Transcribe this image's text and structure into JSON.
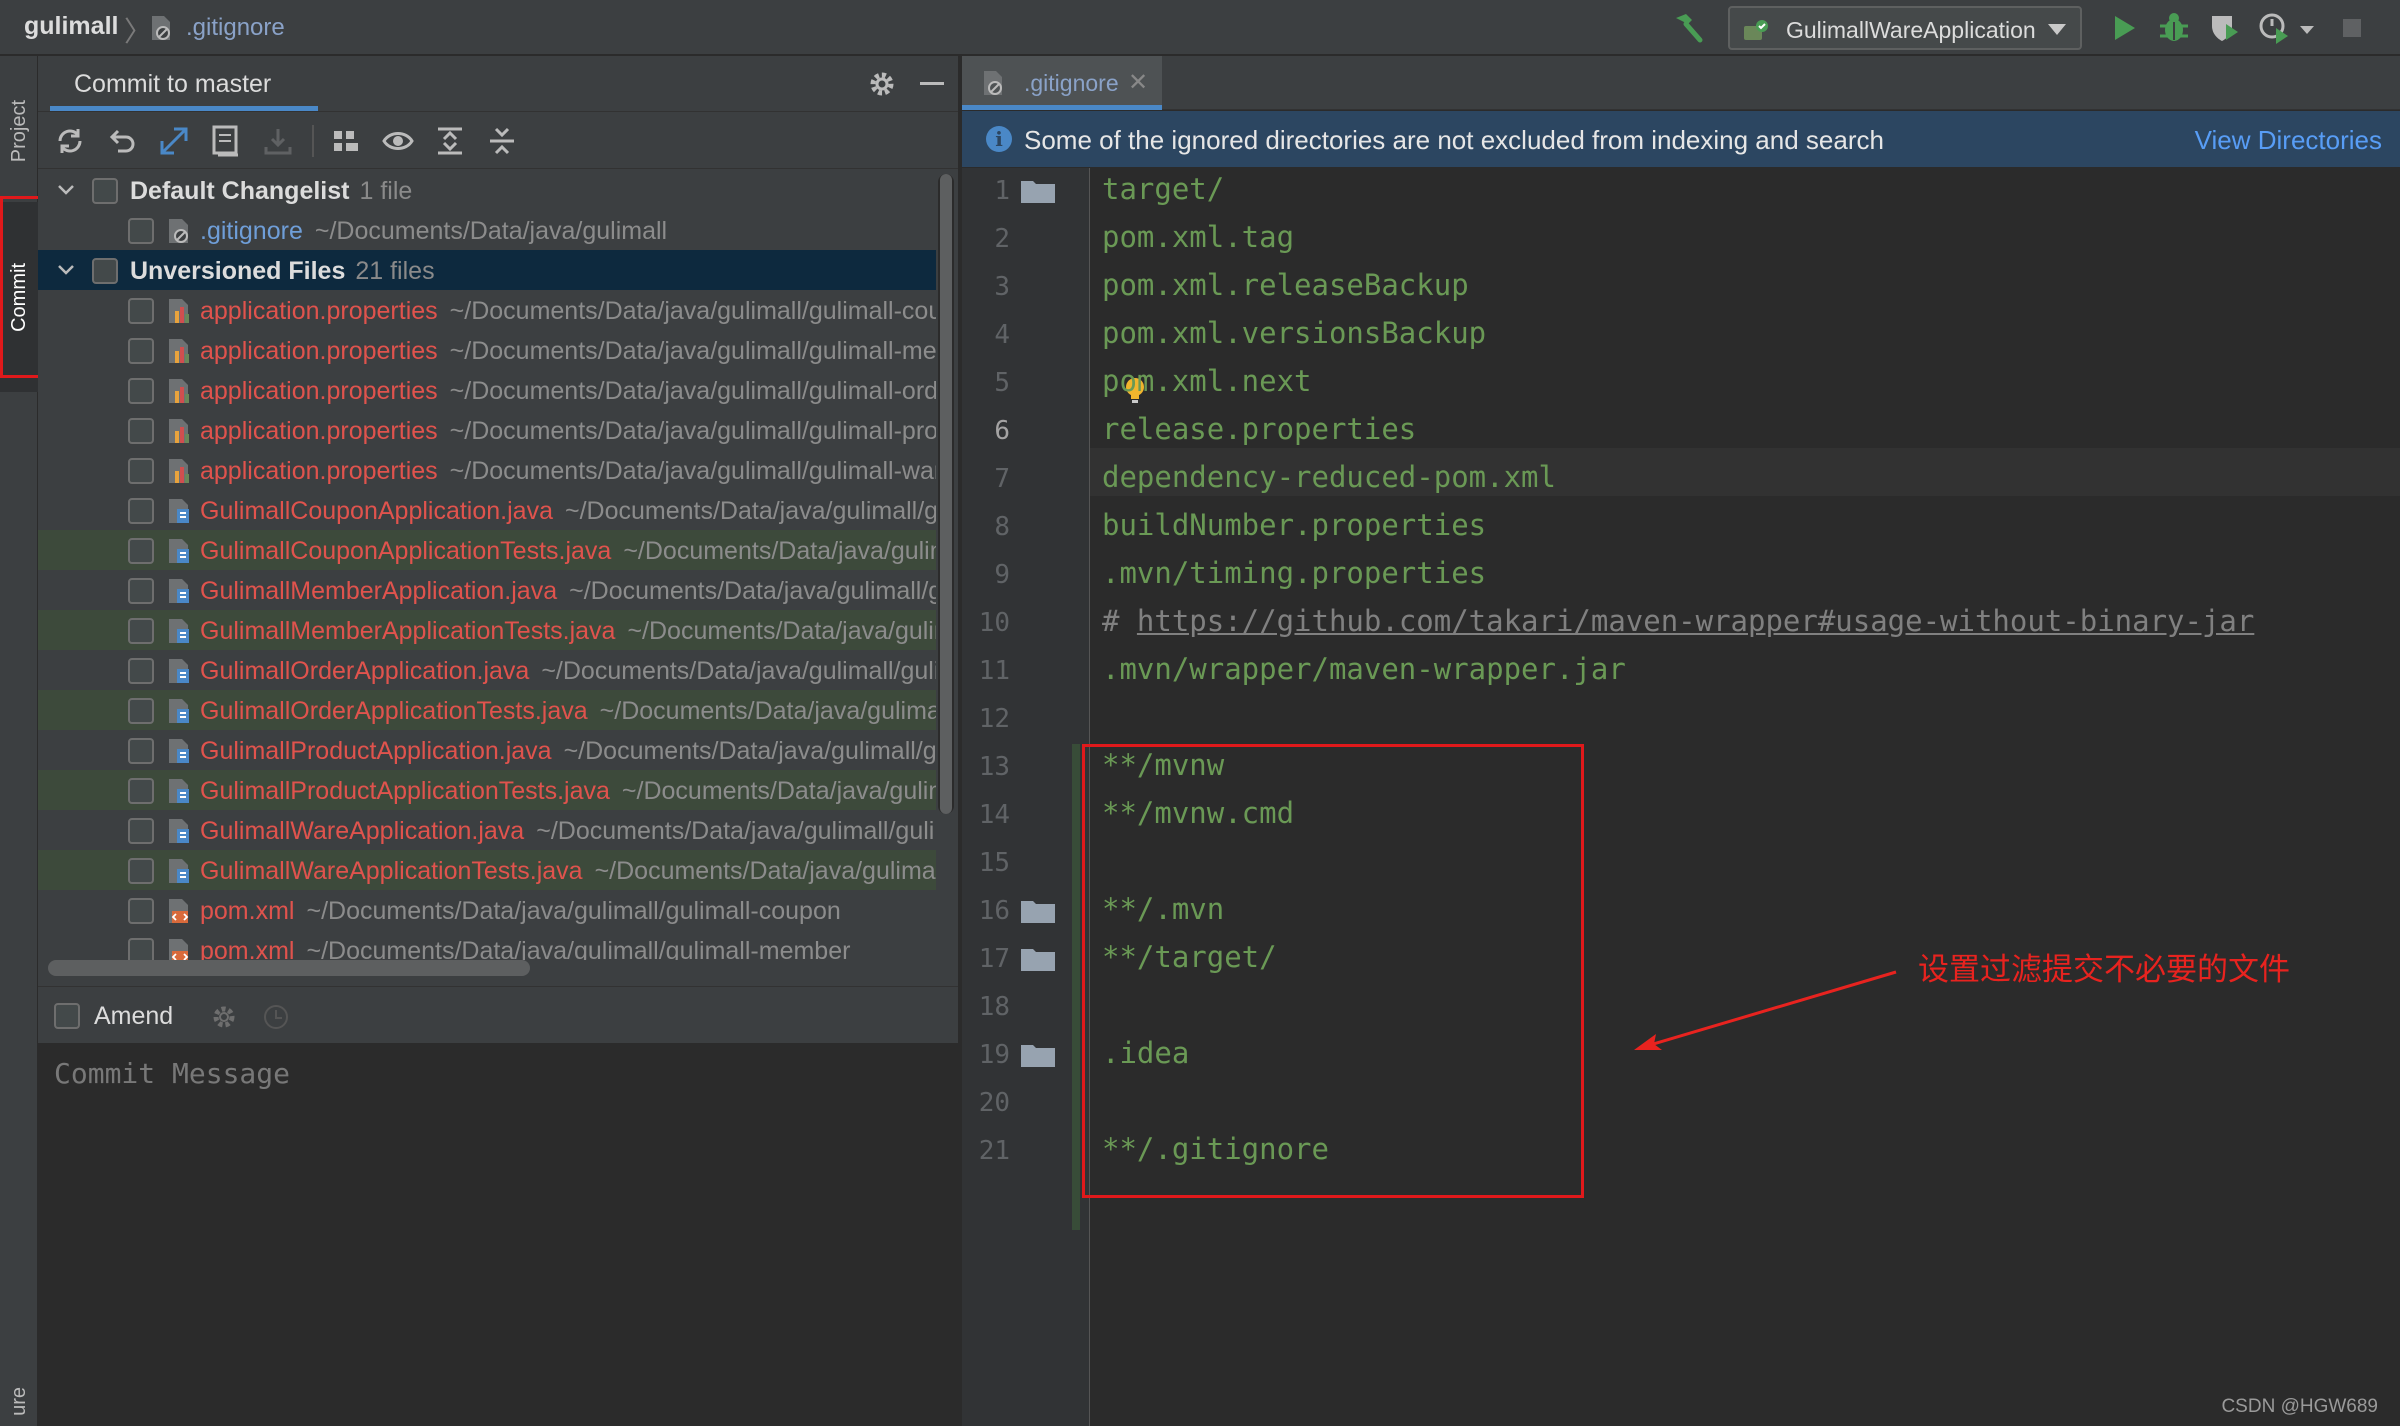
{
  "topbar": {
    "project": "gulimall",
    "file": ".gitignore",
    "run_config": "GulimallWareApplication",
    "actions": [
      {
        "name": "build-hammer-icon",
        "color": "#499c54"
      },
      {
        "name": "run-icon",
        "color": "#499c54"
      },
      {
        "name": "debug-icon",
        "color": "#499c54"
      },
      {
        "name": "coverage-icon",
        "color": "#bbbbbb"
      },
      {
        "name": "profile-icon",
        "color": "#bbbbbb"
      },
      {
        "name": "stop-icon",
        "color": "#5f6163"
      }
    ]
  },
  "left_strip": {
    "tabs": [
      "Project",
      "Commit",
      "ure"
    ]
  },
  "commit_panel": {
    "title": "Commit to master",
    "changelists": [
      {
        "name": "Default Changelist",
        "count": "1 file",
        "files": [
          {
            "name": ".gitignore",
            "path": "~/Documents/Data/java/gulimall",
            "color": "blue",
            "icon": "ignore-file-icon",
            "highlight": false
          }
        ]
      },
      {
        "name": "Unversioned Files",
        "count": "21 files",
        "selected": true,
        "files": [
          {
            "name": "application.properties",
            "path": "~/Documents/Data/java/gulimall/gulimall-coupon/src/main/resources",
            "color": "red",
            "icon": "properties-file-icon",
            "highlight": false
          },
          {
            "name": "application.properties",
            "path": "~/Documents/Data/java/gulimall/gulimall-member/src/main/resources",
            "color": "red",
            "icon": "properties-file-icon",
            "highlight": false
          },
          {
            "name": "application.properties",
            "path": "~/Documents/Data/java/gulimall/gulimall-order/src/main/resources",
            "color": "red",
            "icon": "properties-file-icon",
            "highlight": false
          },
          {
            "name": "application.properties",
            "path": "~/Documents/Data/java/gulimall/gulimall-product/src/main/resources",
            "color": "red",
            "icon": "properties-file-icon",
            "highlight": false
          },
          {
            "name": "application.properties",
            "path": "~/Documents/Data/java/gulimall/gulimall-ware/src/main/resources",
            "color": "red",
            "icon": "properties-file-icon",
            "highlight": false
          },
          {
            "name": "GulimallCouponApplication.java",
            "path": "~/Documents/Data/java/gulimall/gulimall-coupon",
            "color": "red",
            "icon": "java-file-icon",
            "highlight": false
          },
          {
            "name": "GulimallCouponApplicationTests.java",
            "path": "~/Documents/Data/java/gulimall",
            "color": "red",
            "icon": "java-file-icon",
            "highlight": true
          },
          {
            "name": "GulimallMemberApplication.java",
            "path": "~/Documents/Data/java/gulimall/gulimall-member",
            "color": "red",
            "icon": "java-file-icon",
            "highlight": false
          },
          {
            "name": "GulimallMemberApplicationTests.java",
            "path": "~/Documents/Data/java/gulimall",
            "color": "red",
            "icon": "java-file-icon",
            "highlight": true
          },
          {
            "name": "GulimallOrderApplication.java",
            "path": "~/Documents/Data/java/gulimall/gulimall-order",
            "color": "red",
            "icon": "java-file-icon",
            "highlight": false
          },
          {
            "name": "GulimallOrderApplicationTests.java",
            "path": "~/Documents/Data/java/gulimall",
            "color": "red",
            "icon": "java-file-icon",
            "highlight": true
          },
          {
            "name": "GulimallProductApplication.java",
            "path": "~/Documents/Data/java/gulimall/gulimall-product",
            "color": "red",
            "icon": "java-file-icon",
            "highlight": false
          },
          {
            "name": "GulimallProductApplicationTests.java",
            "path": "~/Documents/Data/java/gulimall",
            "color": "red",
            "icon": "java-file-icon",
            "highlight": true
          },
          {
            "name": "GulimallWareApplication.java",
            "path": "~/Documents/Data/java/gulimall/gulimall-ware",
            "color": "red",
            "icon": "java-file-icon",
            "highlight": false
          },
          {
            "name": "GulimallWareApplicationTests.java",
            "path": "~/Documents/Data/java/gulimall",
            "color": "red",
            "icon": "java-file-icon",
            "highlight": true
          },
          {
            "name": "pom.xml",
            "path": "~/Documents/Data/java/gulimall/gulimall-coupon",
            "color": "red",
            "icon": "xml-file-icon",
            "highlight": false
          },
          {
            "name": "pom.xml",
            "path": "~/Documents/Data/java/gulimall/gulimall-member",
            "color": "red",
            "icon": "xml-file-icon",
            "highlight": false
          }
        ]
      }
    ],
    "amend_label": "Amend",
    "commit_message_placeholder": "Commit Message"
  },
  "editor": {
    "tab": ".gitignore",
    "banner_text": "Some of the ignored directories are not excluded from indexing and search",
    "banner_link": "View Directories",
    "current_line": 6,
    "lines": [
      {
        "n": "1",
        "text": "target/",
        "folder": true
      },
      {
        "n": "2",
        "text": "pom.xml.tag",
        "folder": false
      },
      {
        "n": "3",
        "text": "pom.xml.releaseBackup",
        "folder": false
      },
      {
        "n": "4",
        "text": "pom.xml.versionsBackup",
        "folder": false
      },
      {
        "n": "5",
        "text": "pom.xml.next",
        "folder": false
      },
      {
        "n": "6",
        "text": "release.properties",
        "folder": false
      },
      {
        "n": "7",
        "text": "dependency-reduced-pom.xml",
        "folder": false
      },
      {
        "n": "8",
        "text": "buildNumber.properties",
        "folder": false
      },
      {
        "n": "9",
        "text": ".mvn/timing.properties",
        "folder": false
      },
      {
        "n": "10",
        "text": "# https://github.com/takari/maven-wrapper#usage-without-binary-jar",
        "folder": false,
        "comment": true
      },
      {
        "n": "11",
        "text": ".mvn/wrapper/maven-wrapper.jar",
        "folder": false
      },
      {
        "n": "12",
        "text": "",
        "folder": false
      },
      {
        "n": "13",
        "text": "**/mvnw",
        "folder": false
      },
      {
        "n": "14",
        "text": "**/mvnw.cmd",
        "folder": false
      },
      {
        "n": "15",
        "text": "",
        "folder": false
      },
      {
        "n": "16",
        "text": "**/.mvn",
        "folder": true
      },
      {
        "n": "17",
        "text": "**/target/",
        "folder": true
      },
      {
        "n": "18",
        "text": "",
        "folder": false
      },
      {
        "n": "19",
        "text": ".idea",
        "folder": true
      },
      {
        "n": "20",
        "text": "",
        "folder": false
      },
      {
        "n": "21",
        "text": "**/.gitignore",
        "folder": false
      }
    ]
  },
  "annotation": {
    "text": "设置过滤提交不必要的文件",
    "color": "#e8231f"
  },
  "watermark": "CSDN @HGW689"
}
